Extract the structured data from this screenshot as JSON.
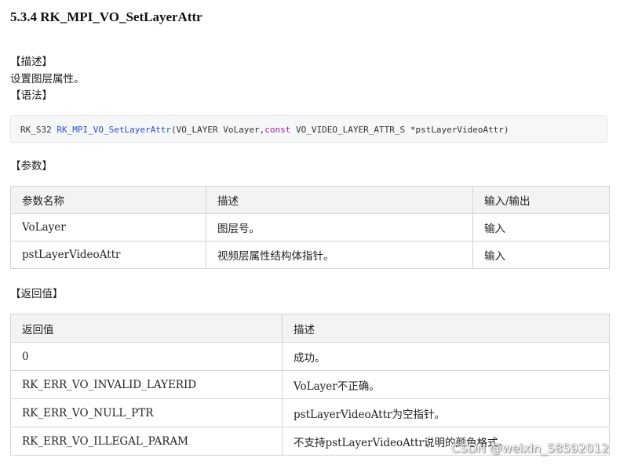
{
  "heading": "5.3.4 RK_MPI_VO_SetLayerAttr",
  "desc_label": "【描述】",
  "desc_text": "设置图层属性。",
  "syntax_label": "【语法】",
  "code": {
    "ret_type": "RK_S32 ",
    "func": "RK_MPI_VO_SetLayerAttr",
    "args_before": "(VO_LAYER VoLayer,",
    "keyword": "const",
    "args_after": " VO_VIDEO_LAYER_ATTR_S *pstLayerVideoAttr)"
  },
  "params_label": "【参数】",
  "params_table": {
    "headers": [
      "参数名称",
      "描述",
      "输入/输出"
    ],
    "rows": [
      [
        "VoLayer",
        "图层号。",
        "输入"
      ],
      [
        "pstLayerVideoAttr",
        "视频层属性结构体指针。",
        "输入"
      ]
    ]
  },
  "return_label": "【返回值】",
  "return_table": {
    "headers": [
      "返回值",
      "描述"
    ],
    "rows": [
      [
        "0",
        "成功。"
      ],
      [
        "RK_ERR_VO_INVALID_LAYERID",
        "VoLayer不正确。"
      ],
      [
        "RK_ERR_VO_NULL_PTR",
        "pstLayerVideoAttr为空指针。"
      ],
      [
        "RK_ERR_VO_ILLEGAL_PARAM",
        "不支持pstLayerVideoAttr说明的颜色格式。"
      ]
    ]
  },
  "watermark": "CSDN @weixin_58592012"
}
